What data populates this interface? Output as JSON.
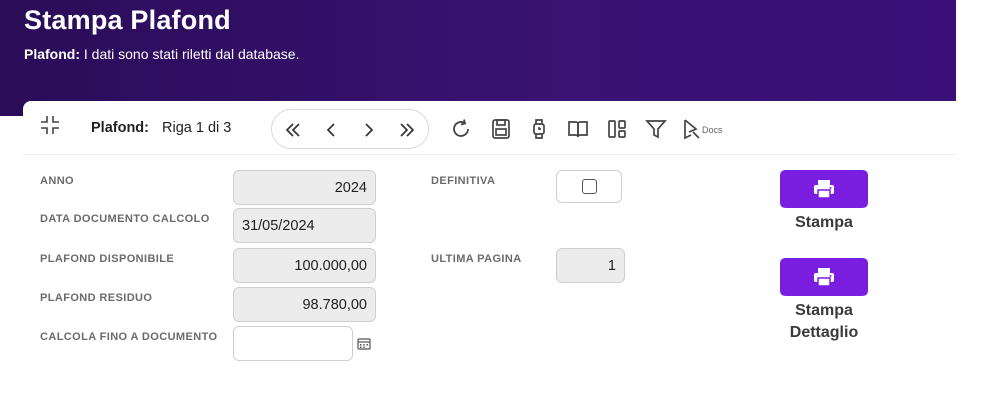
{
  "header": {
    "title": "Stampa Plafond",
    "subtitle_label": "Plafond:",
    "subtitle_text": "I dati sono stati riletti dal database."
  },
  "toolbar": {
    "record_label": "Plafond:",
    "record_value": "Riga 1 di 3",
    "docs_label": "Docs",
    "icons": [
      "collapse-icon",
      "first-icon",
      "prev-icon",
      "next-icon",
      "last-icon",
      "refresh-icon",
      "save-icon",
      "watch-icon",
      "book-icon",
      "layout-icon",
      "filter-icon",
      "docs-icon"
    ]
  },
  "form": {
    "anno": {
      "label": "ANNO",
      "value": "2024"
    },
    "data_documento": {
      "label": "DATA DOCUMENTO CALCOLO",
      "value": "31/05/2024"
    },
    "plafond_disponibile": {
      "label": "PLAFOND DISPONIBILE",
      "value": "100.000,00"
    },
    "plafond_residuo": {
      "label": "PLAFOND RESIDUO",
      "value": "98.780,00"
    },
    "calcola_fino": {
      "label": "CALCOLA FINO A DOCUMENTO",
      "value": ""
    },
    "definitiva": {
      "label": "DEFINITIVA",
      "checked": false
    },
    "ultima_pagina": {
      "label": "ULTIMA PAGINA",
      "value": "1"
    }
  },
  "actions": {
    "stampa_label": "Stampa",
    "stampa_dettaglio_line1": "Stampa",
    "stampa_dettaglio_line2": "Dettaglio"
  },
  "colors": {
    "header_bg": "#2e0f62",
    "accent": "#7a1fe0"
  }
}
